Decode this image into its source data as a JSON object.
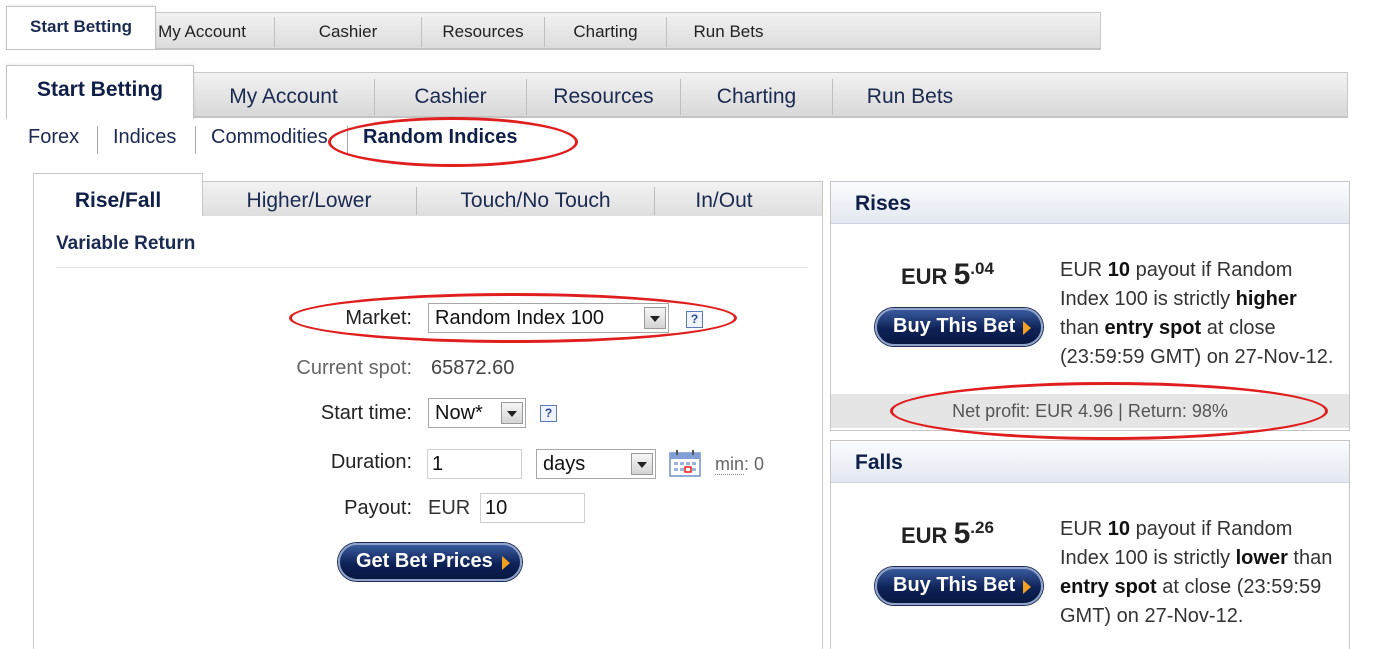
{
  "top_tabs_small": [
    "Start Betting",
    "My Account",
    "Cashier",
    "Resources",
    "Charting",
    "Run Bets"
  ],
  "top_tabs": [
    "Start Betting",
    "My Account",
    "Cashier",
    "Resources",
    "Charting",
    "Run Bets"
  ],
  "subnav": [
    "Forex",
    "Indices",
    "Commodities",
    "Random Indices"
  ],
  "bet_tabs": [
    "Rise/Fall",
    "Higher/Lower",
    "Touch/No Touch",
    "In/Out"
  ],
  "form": {
    "title": "Variable Return",
    "market_label": "Market:",
    "market_value": "Random Index 100",
    "spot_label": "Current spot:",
    "spot_value": "65872.60",
    "start_label": "Start time:",
    "start_value": "Now*",
    "duration_label": "Duration:",
    "duration_value": "1",
    "duration_unit": "days",
    "min_prefix": "min",
    "min_suffix": ": 0",
    "payout_label": "Payout:",
    "payout_currency": "EUR",
    "payout_value": "10",
    "button": "Get Bet Prices",
    "help_glyph": "?"
  },
  "rises": {
    "title": "Rises",
    "currency": "EUR",
    "price_int": "5",
    "price_dec": ".04",
    "button": "Buy This Bet",
    "desc_1": "EUR ",
    "desc_amount": "10",
    "desc_2": " payout if Random Index 100 is strictly ",
    "desc_dir": "higher",
    "desc_3": " than ",
    "desc_spot": "entry spot",
    "desc_4": " at close (23:59:59 GMT) on 27-Nov-12.",
    "net": "Net profit: EUR 4.96 | Return: 98%"
  },
  "falls": {
    "title": "Falls",
    "currency": "EUR",
    "price_int": "5",
    "price_dec": ".26",
    "button": "Buy This Bet",
    "desc_1": "EUR ",
    "desc_amount": "10",
    "desc_2": " payout if Random Index 100 is strictly ",
    "desc_dir": "lower",
    "desc_3": " than ",
    "desc_spot": "entry spot",
    "desc_4": " at close (23:59:59 GMT) on 27-Nov-12."
  },
  "colors": {
    "annotation": "#e01e1e",
    "brand_navy": "#0f1f48",
    "button_arrow": "#f3a022"
  },
  "icons": {
    "help": "help-icon",
    "calendar": "calendar-icon",
    "dropdown": "chevron-down-icon"
  }
}
